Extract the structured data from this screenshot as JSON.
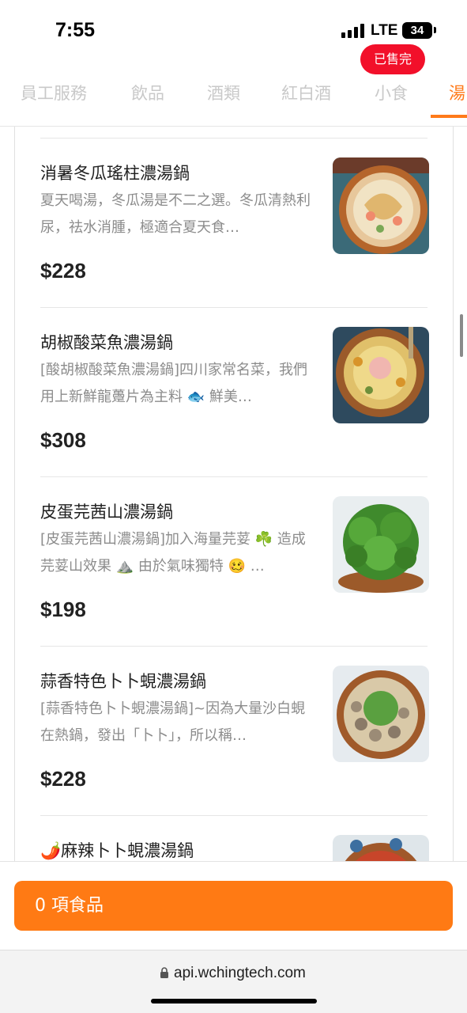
{
  "status_bar": {
    "time": "7:55",
    "network": "LTE",
    "battery": "34"
  },
  "tabs": [
    {
      "label": "員工服務",
      "active": false
    },
    {
      "label": "飲品",
      "active": false
    },
    {
      "label": "酒類",
      "active": false
    },
    {
      "label": "紅白酒",
      "active": false
    },
    {
      "label": "小食",
      "active": false
    },
    {
      "label": "湯",
      "active": true
    }
  ],
  "items": [
    {
      "name": "消暑冬瓜瑤柱濃湯鍋",
      "description": "夏天喝湯，冬瓜湯是不二之選。冬瓜清熱利尿，祛水消腫，極適合夏天食…",
      "price": "$228",
      "badge": "已售完"
    },
    {
      "name": "胡椒酸菜魚濃湯鍋",
      "description": "[酸胡椒酸菜魚濃湯鍋]四川家常名菜，我們用上新鮮龍躉片為主料 🐟 鮮美…",
      "price": "$308"
    },
    {
      "name": "皮蛋芫茜山濃湯鍋",
      "description": "[皮蛋芫茜山濃湯鍋]加入海量芫荽 ☘️ 造成芫荽山效果 ⛰️ 由於氣味獨特 🥴 …",
      "price": "$198"
    },
    {
      "name": "蒜香特色卜卜蜆濃湯鍋",
      "description": "[蒜香特色卜卜蜆濃湯鍋]~因為大量沙白蜆在熱鍋，發出「卜卜」，所以稱…",
      "price": "$228"
    },
    {
      "name": "🌶️麻辣卜卜蜆濃湯鍋",
      "description": "",
      "price": ""
    }
  ],
  "cart": {
    "label": "0 項食品"
  },
  "browser": {
    "url": "api.wchingtech.com"
  },
  "colors": {
    "accent": "#ff7a14",
    "soldout": "#f2102a",
    "inactive_tab": "#c9c9c9"
  }
}
